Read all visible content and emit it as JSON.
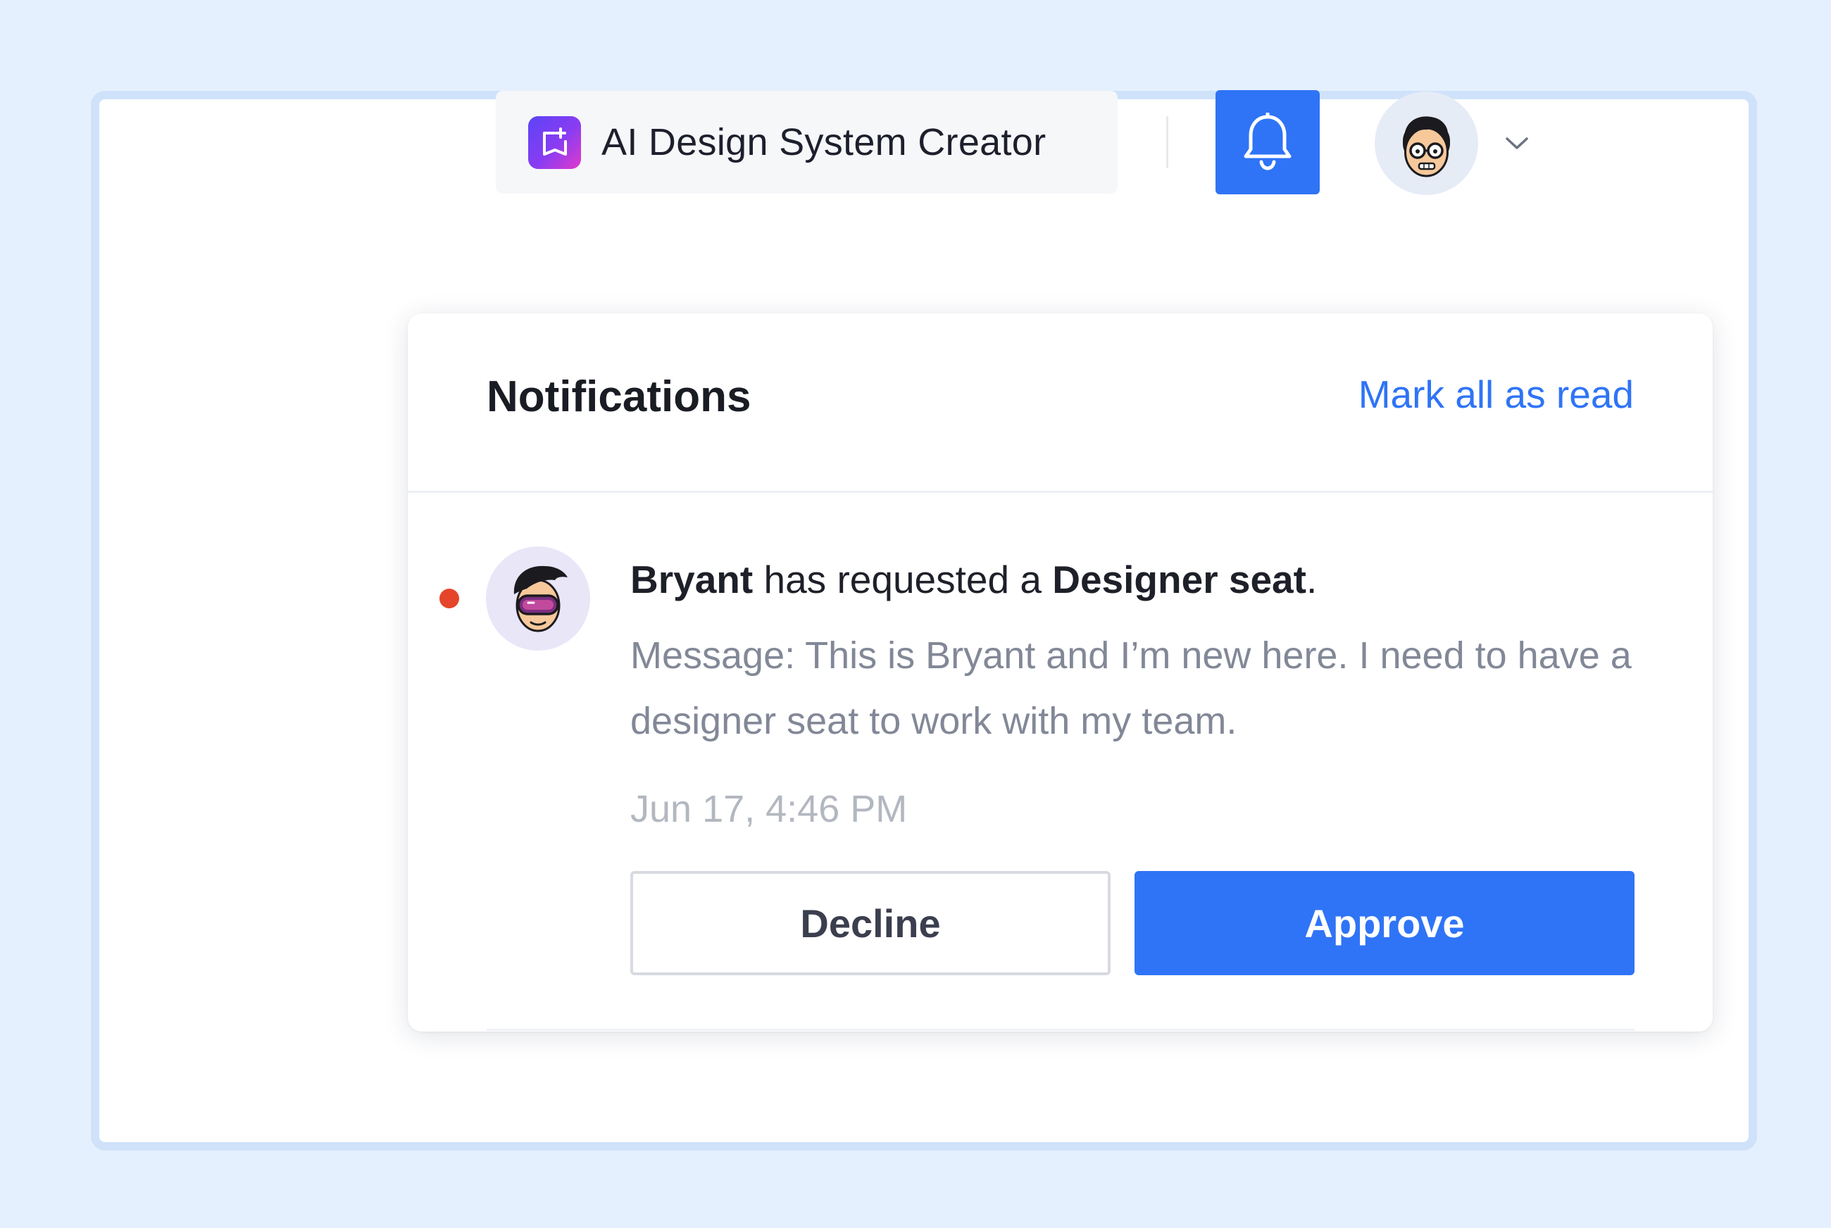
{
  "header": {
    "project_name": "AI Design System Creator",
    "project_logo_icon": "sparkle-book-icon",
    "notifications_icon": "bell-icon",
    "account_menu_icon": "chevron-down-icon"
  },
  "notifications": {
    "title": "Notifications",
    "mark_all_read_label": "Mark all as read",
    "items": [
      {
        "unread": true,
        "requester_name": "Bryant",
        "action_text": " has requested a ",
        "requested_item": "Designer seat",
        "end_punct": ".",
        "message": "Message: This is Bryant and I’m new here. I need to have a designer seat to work with my team.",
        "timestamp": "Jun 17, 4:46 PM",
        "decline_label": "Decline",
        "approve_label": "Approve"
      }
    ]
  },
  "colors": {
    "accent": "#2F74F6",
    "unread_dot": "#E5452A",
    "page_background": "#E5F0FE"
  }
}
